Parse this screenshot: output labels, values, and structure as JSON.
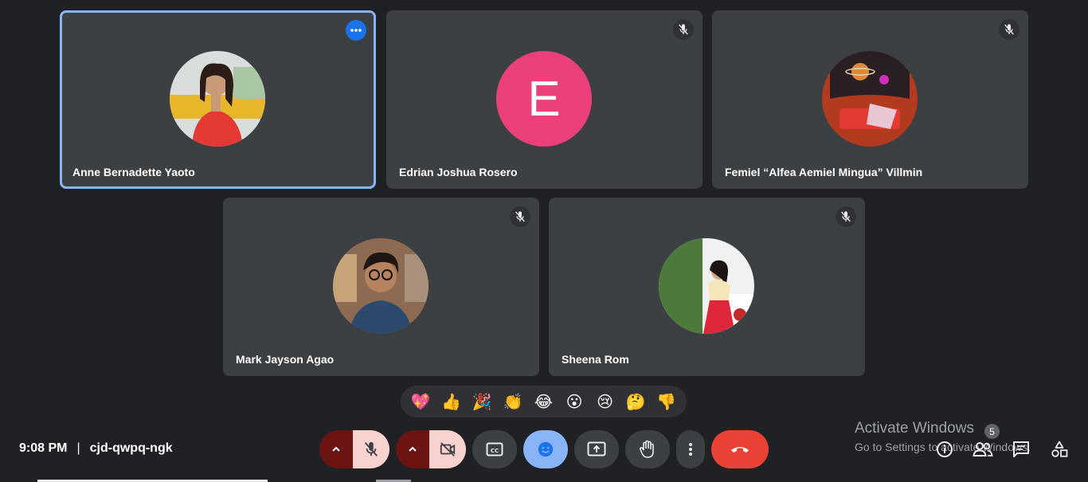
{
  "participants": [
    {
      "name": "Anne Bernadette Yaoto",
      "active": true,
      "avatar": "photo-woman-red-dress"
    },
    {
      "name": "Edrian Joshua Rosero",
      "avatar_letter": "E",
      "avatar_color": "#ec407a"
    },
    {
      "name": "Femiel “Alfea Aemiel Mingua” Villmin",
      "avatar": "illustration-space"
    },
    {
      "name": "Mark Jayson Agao",
      "avatar": "photo-man-glasses"
    },
    {
      "name": "Sheena Rom",
      "avatar": "photo-woman-hanbok"
    }
  ],
  "reactions": [
    "💖",
    "👍",
    "🎉",
    "👏",
    "😂",
    "😮",
    "😢",
    "🤔",
    "👎"
  ],
  "meeting": {
    "time": "9:08 PM",
    "separator": "|",
    "code": "cjd-qwpq-ngk"
  },
  "watermark": {
    "title": "Activate Windows",
    "subtitle": "Go to Settings to activate Windows."
  },
  "people_count": "5",
  "colors": {
    "background": "#202124",
    "tile": "#3c4043",
    "accent": "#8ab4f8",
    "end_call": "#ea4335",
    "reaction_active": "#8ab4f8"
  }
}
